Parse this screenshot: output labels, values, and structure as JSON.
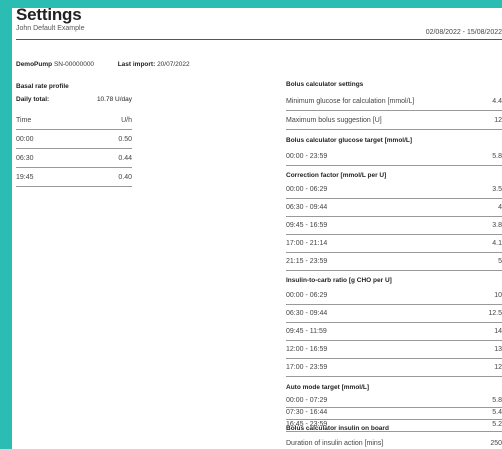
{
  "header": {
    "title": "Settings",
    "subtitle": "John Default Example",
    "date_range": "02/08/2022 - 15/08/2022"
  },
  "device": {
    "name": "DemoPump",
    "serial": "SN-00000000",
    "last_import_label": "Last import:",
    "last_import_value": "20/07/2022"
  },
  "basal": {
    "title": "Basal rate profile",
    "daily_total_label": "Daily total:",
    "daily_total_value": "10.78 U/day",
    "col_time": "Time",
    "col_unit": "U/h",
    "rows": [
      {
        "time": "00:00",
        "value": "0.50"
      },
      {
        "time": "06:30",
        "value": "0.44"
      },
      {
        "time": "19:45",
        "value": "0.40"
      }
    ]
  },
  "bolus_settings": {
    "title": "Bolus calculator settings",
    "rows": [
      {
        "label": "Minimum glucose for calculation [mmol/L]",
        "value": "4.4"
      },
      {
        "label": "Maximum bolus suggestion [U]",
        "value": "12"
      }
    ]
  },
  "glucose_target": {
    "title": "Bolus calculator glucose target [mmol/L]",
    "rows": [
      {
        "label": "00:00 - 23:59",
        "value": "5.8"
      }
    ]
  },
  "correction_factor": {
    "title": "Correction factor [mmol/L per U]",
    "rows": [
      {
        "label": "00:00 - 06:29",
        "value": "3.5"
      },
      {
        "label": "06:30 - 09:44",
        "value": "4"
      },
      {
        "label": "09:45 - 16:59",
        "value": "3.8"
      },
      {
        "label": "17:00 - 21:14",
        "value": "4.1"
      },
      {
        "label": "21:15 - 23:59",
        "value": "5"
      }
    ]
  },
  "carb_ratio": {
    "title": "Insulin-to-carb ratio [g CHO per U]",
    "rows": [
      {
        "label": "00:00 - 06:29",
        "value": "10"
      },
      {
        "label": "06:30 - 09:44",
        "value": "12.5"
      },
      {
        "label": "09:45 - 11:59",
        "value": "14"
      },
      {
        "label": "12:00 - 16:59",
        "value": "13"
      },
      {
        "label": "17:00 - 23:59",
        "value": "12"
      }
    ]
  },
  "auto_mode": {
    "title": "Auto mode target [mmol/L]",
    "rows": [
      {
        "label": "00:00 - 07:29",
        "value": "5.8"
      },
      {
        "label": "07:30 - 16:44",
        "value": "5.4"
      },
      {
        "label": "16:45 - 23:59",
        "value": "5.2"
      }
    ]
  },
  "iob": {
    "title": "Bolus calculator insulin on board",
    "rows": [
      {
        "label": "Duration of insulin action [mins]",
        "value": "250"
      }
    ]
  }
}
